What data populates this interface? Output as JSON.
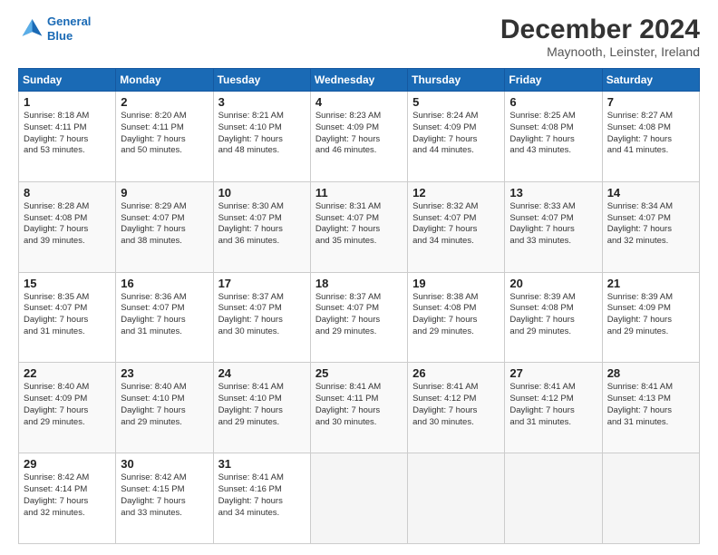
{
  "header": {
    "logo_line1": "General",
    "logo_line2": "Blue",
    "title": "December 2024",
    "subtitle": "Maynooth, Leinster, Ireland"
  },
  "weekdays": [
    "Sunday",
    "Monday",
    "Tuesday",
    "Wednesday",
    "Thursday",
    "Friday",
    "Saturday"
  ],
  "weeks": [
    [
      {
        "day": "1",
        "lines": [
          "Sunrise: 8:18 AM",
          "Sunset: 4:11 PM",
          "Daylight: 7 hours",
          "and 53 minutes."
        ]
      },
      {
        "day": "2",
        "lines": [
          "Sunrise: 8:20 AM",
          "Sunset: 4:11 PM",
          "Daylight: 7 hours",
          "and 50 minutes."
        ]
      },
      {
        "day": "3",
        "lines": [
          "Sunrise: 8:21 AM",
          "Sunset: 4:10 PM",
          "Daylight: 7 hours",
          "and 48 minutes."
        ]
      },
      {
        "day": "4",
        "lines": [
          "Sunrise: 8:23 AM",
          "Sunset: 4:09 PM",
          "Daylight: 7 hours",
          "and 46 minutes."
        ]
      },
      {
        "day": "5",
        "lines": [
          "Sunrise: 8:24 AM",
          "Sunset: 4:09 PM",
          "Daylight: 7 hours",
          "and 44 minutes."
        ]
      },
      {
        "day": "6",
        "lines": [
          "Sunrise: 8:25 AM",
          "Sunset: 4:08 PM",
          "Daylight: 7 hours",
          "and 43 minutes."
        ]
      },
      {
        "day": "7",
        "lines": [
          "Sunrise: 8:27 AM",
          "Sunset: 4:08 PM",
          "Daylight: 7 hours",
          "and 41 minutes."
        ]
      }
    ],
    [
      {
        "day": "8",
        "lines": [
          "Sunrise: 8:28 AM",
          "Sunset: 4:08 PM",
          "Daylight: 7 hours",
          "and 39 minutes."
        ]
      },
      {
        "day": "9",
        "lines": [
          "Sunrise: 8:29 AM",
          "Sunset: 4:07 PM",
          "Daylight: 7 hours",
          "and 38 minutes."
        ]
      },
      {
        "day": "10",
        "lines": [
          "Sunrise: 8:30 AM",
          "Sunset: 4:07 PM",
          "Daylight: 7 hours",
          "and 36 minutes."
        ]
      },
      {
        "day": "11",
        "lines": [
          "Sunrise: 8:31 AM",
          "Sunset: 4:07 PM",
          "Daylight: 7 hours",
          "and 35 minutes."
        ]
      },
      {
        "day": "12",
        "lines": [
          "Sunrise: 8:32 AM",
          "Sunset: 4:07 PM",
          "Daylight: 7 hours",
          "and 34 minutes."
        ]
      },
      {
        "day": "13",
        "lines": [
          "Sunrise: 8:33 AM",
          "Sunset: 4:07 PM",
          "Daylight: 7 hours",
          "and 33 minutes."
        ]
      },
      {
        "day": "14",
        "lines": [
          "Sunrise: 8:34 AM",
          "Sunset: 4:07 PM",
          "Daylight: 7 hours",
          "and 32 minutes."
        ]
      }
    ],
    [
      {
        "day": "15",
        "lines": [
          "Sunrise: 8:35 AM",
          "Sunset: 4:07 PM",
          "Daylight: 7 hours",
          "and 31 minutes."
        ]
      },
      {
        "day": "16",
        "lines": [
          "Sunrise: 8:36 AM",
          "Sunset: 4:07 PM",
          "Daylight: 7 hours",
          "and 31 minutes."
        ]
      },
      {
        "day": "17",
        "lines": [
          "Sunrise: 8:37 AM",
          "Sunset: 4:07 PM",
          "Daylight: 7 hours",
          "and 30 minutes."
        ]
      },
      {
        "day": "18",
        "lines": [
          "Sunrise: 8:37 AM",
          "Sunset: 4:07 PM",
          "Daylight: 7 hours",
          "and 29 minutes."
        ]
      },
      {
        "day": "19",
        "lines": [
          "Sunrise: 8:38 AM",
          "Sunset: 4:08 PM",
          "Daylight: 7 hours",
          "and 29 minutes."
        ]
      },
      {
        "day": "20",
        "lines": [
          "Sunrise: 8:39 AM",
          "Sunset: 4:08 PM",
          "Daylight: 7 hours",
          "and 29 minutes."
        ]
      },
      {
        "day": "21",
        "lines": [
          "Sunrise: 8:39 AM",
          "Sunset: 4:09 PM",
          "Daylight: 7 hours",
          "and 29 minutes."
        ]
      }
    ],
    [
      {
        "day": "22",
        "lines": [
          "Sunrise: 8:40 AM",
          "Sunset: 4:09 PM",
          "Daylight: 7 hours",
          "and 29 minutes."
        ]
      },
      {
        "day": "23",
        "lines": [
          "Sunrise: 8:40 AM",
          "Sunset: 4:10 PM",
          "Daylight: 7 hours",
          "and 29 minutes."
        ]
      },
      {
        "day": "24",
        "lines": [
          "Sunrise: 8:41 AM",
          "Sunset: 4:10 PM",
          "Daylight: 7 hours",
          "and 29 minutes."
        ]
      },
      {
        "day": "25",
        "lines": [
          "Sunrise: 8:41 AM",
          "Sunset: 4:11 PM",
          "Daylight: 7 hours",
          "and 30 minutes."
        ]
      },
      {
        "day": "26",
        "lines": [
          "Sunrise: 8:41 AM",
          "Sunset: 4:12 PM",
          "Daylight: 7 hours",
          "and 30 minutes."
        ]
      },
      {
        "day": "27",
        "lines": [
          "Sunrise: 8:41 AM",
          "Sunset: 4:12 PM",
          "Daylight: 7 hours",
          "and 31 minutes."
        ]
      },
      {
        "day": "28",
        "lines": [
          "Sunrise: 8:41 AM",
          "Sunset: 4:13 PM",
          "Daylight: 7 hours",
          "and 31 minutes."
        ]
      }
    ],
    [
      {
        "day": "29",
        "lines": [
          "Sunrise: 8:42 AM",
          "Sunset: 4:14 PM",
          "Daylight: 7 hours",
          "and 32 minutes."
        ]
      },
      {
        "day": "30",
        "lines": [
          "Sunrise: 8:42 AM",
          "Sunset: 4:15 PM",
          "Daylight: 7 hours",
          "and 33 minutes."
        ]
      },
      {
        "day": "31",
        "lines": [
          "Sunrise: 8:41 AM",
          "Sunset: 4:16 PM",
          "Daylight: 7 hours",
          "and 34 minutes."
        ]
      },
      null,
      null,
      null,
      null
    ]
  ]
}
